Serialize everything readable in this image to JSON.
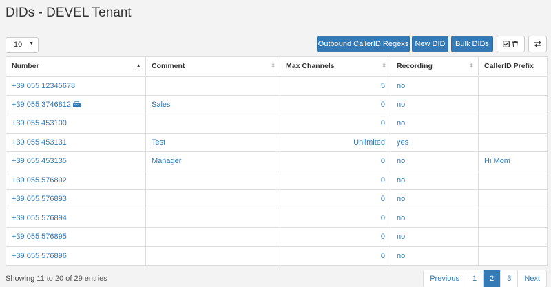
{
  "page": {
    "title": "DIDs - DEVEL Tenant"
  },
  "controls": {
    "page_size": "10",
    "outbound_label": "Outbound CallerID Regexs",
    "new_label": "New DID",
    "bulk_label": "Bulk DIDs"
  },
  "table": {
    "headers": [
      "Number",
      "Comment",
      "Max Channels",
      "Recording",
      "CallerID Prefix"
    ],
    "rows": [
      {
        "number": "+39 055 12345678",
        "comment": "",
        "max": "5",
        "rec": "no",
        "prefix": ""
      },
      {
        "number": "+39 055 3746812",
        "comment": "Sales",
        "max": "0",
        "rec": "no",
        "prefix": ""
      },
      {
        "number": "+39 055 453100",
        "comment": "",
        "max": "0",
        "rec": "no",
        "prefix": ""
      },
      {
        "number": "+39 055 453131",
        "comment": "Test",
        "max": "Unlimited",
        "rec": "yes",
        "prefix": ""
      },
      {
        "number": "+39 055 453135",
        "comment": "Manager",
        "max": "0",
        "rec": "no",
        "prefix": "Hi Mom"
      },
      {
        "number": "+39 055 576892",
        "comment": "",
        "max": "0",
        "rec": "no",
        "prefix": ""
      },
      {
        "number": "+39 055 576893",
        "comment": "",
        "max": "0",
        "rec": "no",
        "prefix": ""
      },
      {
        "number": "+39 055 576894",
        "comment": "",
        "max": "0",
        "rec": "no",
        "prefix": ""
      },
      {
        "number": "+39 055 576895",
        "comment": "",
        "max": "0",
        "rec": "no",
        "prefix": ""
      },
      {
        "number": "+39 055 576896",
        "comment": "",
        "max": "0",
        "rec": "no",
        "prefix": ""
      }
    ]
  },
  "footer": {
    "info": "Showing 11 to 20 of 29 entries",
    "pagination": {
      "previous": "Previous",
      "pages": [
        "1",
        "2",
        "3"
      ],
      "next": "Next"
    }
  },
  "icons": {
    "fax": "fax-icon",
    "edit": "check-square-icon",
    "delete": "trash-icon",
    "columns": "exchange-icon"
  },
  "colors": {
    "primary": "#337ab7",
    "link": "#337ab7"
  }
}
